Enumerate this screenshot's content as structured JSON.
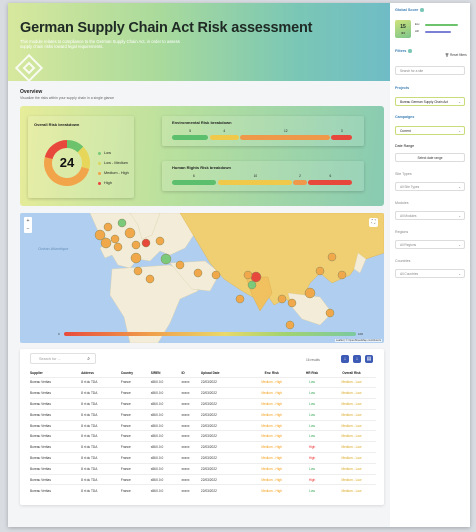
{
  "hero": {
    "title": "German Supply Chain Act Risk assessment",
    "subtitle": "This module relates to compliance to the German Supply Chain Act, in order to assess supply chain risks toward legal requirements."
  },
  "overview": {
    "title": "Overview",
    "subtitle": "Visualize the risks within your supply chain in a single glance"
  },
  "overall": {
    "title": "Overall Risk breakdown",
    "total": "24",
    "legend": [
      {
        "label": "Low",
        "color": "#7bc97b"
      },
      {
        "label": "Low - Medium",
        "color": "#d8d85a"
      },
      {
        "label": "Medium - High",
        "color": "#f2a44a"
      },
      {
        "label": "High",
        "color": "#e8483c"
      }
    ],
    "slices": [
      3,
      4,
      12,
      5
    ],
    "slice_colors": [
      "#6cc36c",
      "#e6d65a",
      "#f2a44a",
      "#e8483c"
    ]
  },
  "environmental": {
    "title": "Environmental Risk breakdown",
    "segments": [
      {
        "label": "5",
        "value": 5,
        "color": "#5cbf6e"
      },
      {
        "label": "4",
        "value": 4,
        "color": "#f1c94a"
      },
      {
        "label": "12",
        "value": 12,
        "color": "#f0984a"
      },
      {
        "label": "3",
        "value": 3,
        "color": "#e8483c"
      }
    ]
  },
  "human_rights": {
    "title": "Human Rights Risk breakdown",
    "segments": [
      {
        "label": "6",
        "value": 6,
        "color": "#5cbf6e"
      },
      {
        "label": "10",
        "value": 10,
        "color": "#f1c94a"
      },
      {
        "label": "2",
        "value": 2,
        "color": "#f0984a"
      },
      {
        "label": "6",
        "value": 6,
        "color": "#e8483c"
      }
    ]
  },
  "map": {
    "ocean_label": "Océan Atlantique",
    "scale_low": "0",
    "scale_high": "100",
    "attribution": "Leaflet | © OpenStreetMap contributors",
    "zoom_in": "+",
    "zoom_out": "−",
    "expand": "⛶"
  },
  "table": {
    "search_placeholder": "Search for ...",
    "results": "16 results",
    "columns": [
      "Supplier",
      "Address",
      "Country",
      "SIREN",
      "ID",
      "Upload Date",
      "Env. Risk",
      "HR Risk",
      "Overall Risk"
    ],
    "rows": [
      [
        "Bureau Veritas",
        "8 rt du TDA",
        "France",
        "x86X.0.0",
        "xxxxx",
        "22/03/2022",
        "Medium - High",
        "Low",
        "Medium - Low"
      ],
      [
        "Bureau Veritas",
        "8 rt du TDA",
        "France",
        "x86X.0.0",
        "xxxxx",
        "22/03/2022",
        "Medium - High",
        "Low",
        "Medium - Low"
      ],
      [
        "Bureau Veritas",
        "8 rt du TDA",
        "France",
        "x86X.0.0",
        "xxxxx",
        "22/03/2022",
        "Medium - High",
        "Low",
        "Medium - Low"
      ],
      [
        "Bureau Veritas",
        "8 rt du TDA",
        "France",
        "x86X.0.0",
        "xxxxx",
        "22/03/2022",
        "Medium - High",
        "Low",
        "Medium - Low"
      ],
      [
        "Bureau Veritas",
        "8 rt du TDA",
        "France",
        "x86X.0.0",
        "xxxxx",
        "22/03/2022",
        "Medium - High",
        "Low",
        "Medium - Low"
      ],
      [
        "Bureau Veritas",
        "8 rt du TDA",
        "France",
        "x86X.0.0",
        "xxxxx",
        "22/03/2022",
        "Medium - High",
        "Low",
        "Medium - Low"
      ],
      [
        "Bureau Veritas",
        "8 rt du TDA",
        "France",
        "x86X.0.0",
        "xxxxx",
        "22/03/2022",
        "Medium - High",
        "High",
        "Medium - Low"
      ],
      [
        "Bureau Veritas",
        "8 rt du TDA",
        "France",
        "x86X.0.0",
        "xxxxx",
        "22/03/2022",
        "Medium - High",
        "High",
        "Medium - Low"
      ],
      [
        "Bureau Veritas",
        "8 rt du TDA",
        "France",
        "x86X.0.0",
        "xxxxx",
        "22/03/2022",
        "Medium - High",
        "Low",
        "Medium - Low"
      ],
      [
        "Bureau Veritas",
        "8 rt du TDA",
        "France",
        "x86X.0.0",
        "xxxxx",
        "22/03/2022",
        "Medium - High",
        "High",
        "Medium - Low"
      ],
      [
        "Bureau Veritas",
        "8 rt du TDA",
        "France",
        "x86X.0.0",
        "xxxxx",
        "22/03/2022",
        "Medium - High",
        "Low",
        "Medium - Low"
      ]
    ]
  },
  "sidebar": {
    "global_score_title": "Global Score",
    "score": "15",
    "score_caption": "/24",
    "score_rows": [
      {
        "label": "Env.",
        "value": 0.82,
        "color": "#6cc36c"
      },
      {
        "label": "HR",
        "value": 0.66,
        "color": "#7b7fd6"
      }
    ],
    "filters_title": "Filters",
    "reset_label": "Reset filters",
    "search_placeholder": "Search for a site",
    "projects_label": "Projects",
    "projects_value": "Bureau German Supply Chain Act",
    "campaigns_label": "Campaigns",
    "campaigns_value": "Current",
    "date_label": "Date Range",
    "date_button": "Select date range",
    "site_types_label": "Site Types",
    "site_types_value": "All Site Types",
    "modules_label": "Modules",
    "modules_value": "All Modules",
    "regions_label": "Regions",
    "regions_value": "All Regions",
    "countries_label": "Countries",
    "countries_value": "All Countries"
  }
}
